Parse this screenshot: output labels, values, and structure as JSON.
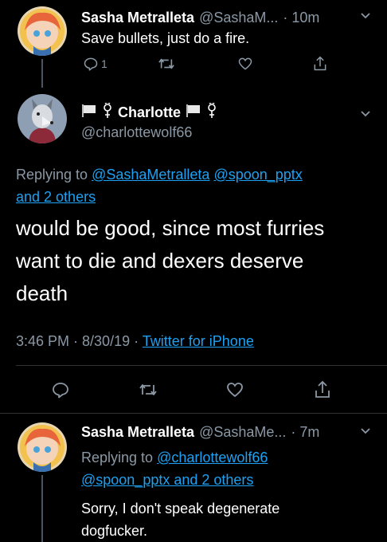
{
  "tweet1": {
    "name": "Sasha Metralleta",
    "handle": "@SashaM...",
    "time": "· 10m",
    "text": "Save bullets, just do a fire.",
    "reply_count": "1"
  },
  "main": {
    "name": "Charlotte",
    "handle": "@charlottewolf66",
    "replying_prefix": "Replying to",
    "mention1": "@SashaMetralleta",
    "mention2": "@spoon_pptx",
    "mention3": "and 2 others",
    "text_line1": "would be good, since most furries",
    "text_line2": "want to die and dexers deserve",
    "text_line3": "death",
    "timestamp": "3:46 PM · 8/30/19 ·",
    "source": "Twitter for iPhone"
  },
  "tweet3": {
    "name": "Sasha Metralleta",
    "handle": "@SashaMe...",
    "time": "· 7m",
    "replying_prefix": "Replying to",
    "mention1": "@charlottewolf66",
    "mention2": "@spoon_pptx and 2 others",
    "text_line1": "Sorry, I don't speak degenerate",
    "text_line2": "dogfucker."
  },
  "colors": {
    "link": "#1da1f2",
    "muted": "#8b98a5",
    "background": "#000000"
  }
}
